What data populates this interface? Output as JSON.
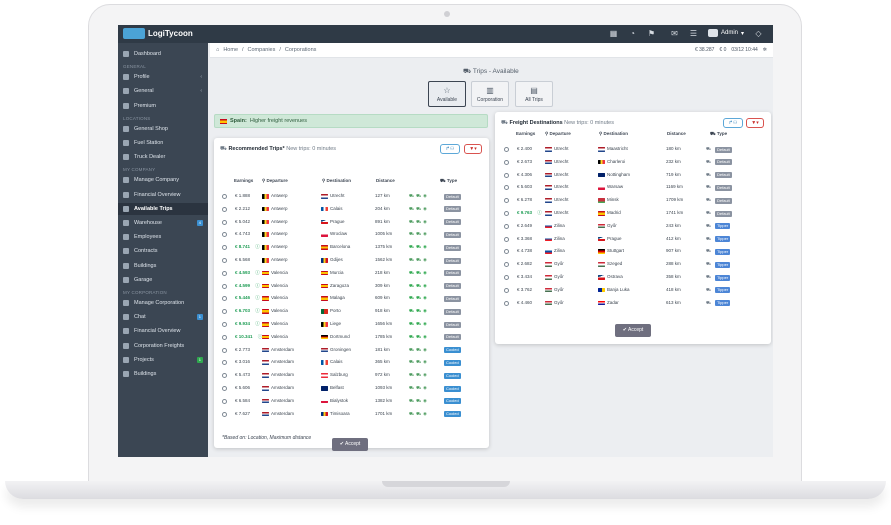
{
  "app": {
    "logo_text": "LogiTycoon",
    "admin_label": "Admin",
    "balance_1": "€ 38.287",
    "balance_2": "€ 0",
    "date": "03/12 10:44"
  },
  "breadcrumb": [
    "Home",
    "Companies",
    "Corporations"
  ],
  "sidebar": {
    "groups": [
      {
        "label": "",
        "items": [
          {
            "label": "Dashboard"
          }
        ]
      },
      {
        "label": "GENERAL",
        "items": [
          {
            "label": "Profile"
          },
          {
            "label": "General"
          },
          {
            "label": "Premium"
          }
        ]
      },
      {
        "label": "LOCATIONS",
        "items": [
          {
            "label": "General Shop"
          },
          {
            "label": "Fuel Station"
          },
          {
            "label": "Truck Dealer"
          }
        ]
      },
      {
        "label": "MY COMPANY",
        "items": [
          {
            "label": "Manage Company"
          },
          {
            "label": "Financial Overview"
          },
          {
            "label": "Available Trips"
          },
          {
            "label": "Warehouse"
          },
          {
            "label": "Employees"
          },
          {
            "label": "Contracts"
          },
          {
            "label": "Buildings"
          },
          {
            "label": "Garage"
          }
        ]
      },
      {
        "label": "MY CORPORATION",
        "items": [
          {
            "label": "Manage Corporation"
          },
          {
            "label": "Chat"
          },
          {
            "label": "Financial Overview"
          },
          {
            "label": "Corporation Freights"
          },
          {
            "label": "Projects"
          },
          {
            "label": "Buildings"
          }
        ]
      }
    ]
  },
  "page": {
    "title": "Trips - Available"
  },
  "categories": [
    {
      "label": "Available"
    },
    {
      "label": "Corporation"
    },
    {
      "label": "All Trips"
    }
  ],
  "alert": {
    "country": "Spain:",
    "text": "Higher freight revenues"
  },
  "recommended": {
    "title": "Recommended Trips*",
    "subtitle": "New trips: 0 minutes",
    "headers": {
      "earnings": "Earnings",
      "departure": "Departure",
      "destination": "Destination",
      "distance": "Distance",
      "type": "Type"
    },
    "accept": "Accept",
    "footnote": "*Based on: Location, Maximum distance",
    "rows": [
      {
        "earn": "€ 1.888",
        "green": false,
        "dep": "Antwerp",
        "depc": "be",
        "dest": "Utrecht",
        "destc": "nl",
        "dist": "127 km",
        "type": "Default"
      },
      {
        "earn": "€ 2.212",
        "green": false,
        "dep": "Antwerp",
        "depc": "be",
        "dest": "Calais",
        "destc": "fr",
        "dist": "204 km",
        "type": "Default"
      },
      {
        "earn": "€ 5.042",
        "green": false,
        "dep": "Antwerp",
        "depc": "be",
        "dest": "Prague",
        "destc": "cz",
        "dist": "891 km",
        "type": "Default"
      },
      {
        "earn": "€ 4.743",
        "green": false,
        "dep": "Antwerp",
        "depc": "be",
        "dest": "Wroclaw",
        "destc": "pl",
        "dist": "1005 km",
        "type": "Default"
      },
      {
        "earn": "€ 8.741",
        "green": true,
        "dep": "Antwerp",
        "depc": "be",
        "dest": "Barcelona",
        "destc": "es",
        "dist": "1375 km",
        "type": "Default"
      },
      {
        "earn": "€ 6.568",
        "green": false,
        "dep": "Antwerp",
        "depc": "be",
        "dest": "Gdijes",
        "destc": "ro",
        "dist": "1562 km",
        "type": "Default"
      },
      {
        "earn": "€ 4.593",
        "green": true,
        "dep": "Valencia",
        "depc": "es",
        "dest": "Murcia",
        "destc": "es",
        "dist": "218 km",
        "type": "Default"
      },
      {
        "earn": "€ 4.599",
        "green": true,
        "dep": "Valencia",
        "depc": "es",
        "dest": "Zaragoza",
        "destc": "es",
        "dist": "309 km",
        "type": "Default"
      },
      {
        "earn": "€ 5.446",
        "green": true,
        "dep": "Valencia",
        "depc": "es",
        "dest": "Malaga",
        "destc": "es",
        "dist": "609 km",
        "type": "Default"
      },
      {
        "earn": "€ 6.703",
        "green": true,
        "dep": "Valencia",
        "depc": "es",
        "dest": "Porto",
        "destc": "pt",
        "dist": "918 km",
        "type": "Default"
      },
      {
        "earn": "€ 9.934",
        "green": true,
        "dep": "Valencia",
        "depc": "es",
        "dest": "Liege",
        "destc": "be",
        "dist": "1656 km",
        "type": "Default"
      },
      {
        "earn": "€ 10.341",
        "green": true,
        "dep": "Valencia",
        "depc": "es",
        "dest": "Dortmund",
        "destc": "de",
        "dist": "1785 km",
        "type": "Default"
      },
      {
        "earn": "€ 2.773",
        "green": false,
        "dep": "Amsterdam",
        "depc": "nl",
        "dest": "Groningen",
        "destc": "nl",
        "dist": "181 km",
        "type": "Cooled"
      },
      {
        "earn": "€ 3.016",
        "green": false,
        "dep": "Amsterdam",
        "depc": "nl",
        "dest": "Calais",
        "destc": "fr",
        "dist": "365 km",
        "type": "Cooled"
      },
      {
        "earn": "€ 5.473",
        "green": false,
        "dep": "Amsterdam",
        "depc": "nl",
        "dest": "Salzburg",
        "destc": "at",
        "dist": "972 km",
        "type": "Cooled"
      },
      {
        "earn": "€ 5.606",
        "green": false,
        "dep": "Amsterdam",
        "depc": "nl",
        "dest": "Belfast",
        "destc": "gb",
        "dist": "1093 km",
        "type": "Cooled"
      },
      {
        "earn": "€ 6.584",
        "green": false,
        "dep": "Amsterdam",
        "depc": "nl",
        "dest": "Bialystok",
        "destc": "pl",
        "dist": "1382 km",
        "type": "Cooled"
      },
      {
        "earn": "€ 7.627",
        "green": false,
        "dep": "Amsterdam",
        "depc": "nl",
        "dest": "Timisoara",
        "destc": "ro",
        "dist": "1701 km",
        "type": "Cooled"
      }
    ]
  },
  "freight": {
    "title": "Freight Destinations",
    "subtitle": "New trips: 0 minutes",
    "headers": {
      "earnings": "Earnings",
      "departure": "Departure",
      "destination": "Destination",
      "distance": "Distance",
      "type": "Type"
    },
    "accept": "Accept",
    "rows": [
      {
        "earn": "€ 2.400",
        "green": false,
        "dep": "Utrecht",
        "depc": "nl",
        "dest": "Maastricht",
        "destc": "nl",
        "dist": "180 km",
        "type": "Default"
      },
      {
        "earn": "€ 2.673",
        "green": false,
        "dep": "Utrecht",
        "depc": "nl",
        "dest": "Charleroi",
        "destc": "be",
        "dist": "232 km",
        "type": "Default"
      },
      {
        "earn": "€ 4.306",
        "green": false,
        "dep": "Utrecht",
        "depc": "nl",
        "dest": "Nottingham",
        "destc": "gb",
        "dist": "719 km",
        "type": "Default"
      },
      {
        "earn": "€ 5.603",
        "green": false,
        "dep": "Utrecht",
        "depc": "nl",
        "dest": "Warsaw",
        "destc": "pl",
        "dist": "1169 km",
        "type": "Default"
      },
      {
        "earn": "€ 6.278",
        "green": false,
        "dep": "Utrecht",
        "depc": "nl",
        "dest": "Minsk",
        "destc": "by",
        "dist": "1709 km",
        "type": "Default"
      },
      {
        "earn": "€ 9.763",
        "green": true,
        "dep": "Utrecht",
        "depc": "nl",
        "dest": "Madrid",
        "destc": "es",
        "dist": "1741 km",
        "type": "Default"
      },
      {
        "earn": "€ 2.649",
        "green": false,
        "dep": "Zilina",
        "depc": "sk",
        "dest": "Győr",
        "destc": "hu",
        "dist": "243 km",
        "type": "Tipper"
      },
      {
        "earn": "€ 3.368",
        "green": false,
        "dep": "Zilina",
        "depc": "sk",
        "dest": "Prague",
        "destc": "cz",
        "dist": "412 km",
        "type": "Tipper"
      },
      {
        "earn": "€ 4.738",
        "green": false,
        "dep": "Zilina",
        "depc": "sk",
        "dest": "Stuttgart",
        "destc": "de",
        "dist": "907 km",
        "type": "Tipper"
      },
      {
        "earn": "€ 2.682",
        "green": false,
        "dep": "Győr",
        "depc": "hu",
        "dest": "Szeged",
        "destc": "hu",
        "dist": "288 km",
        "type": "Tipper"
      },
      {
        "earn": "€ 3.434",
        "green": false,
        "dep": "Győr",
        "depc": "hu",
        "dest": "Ostrava",
        "destc": "cz",
        "dist": "358 km",
        "type": "Tipper"
      },
      {
        "earn": "€ 3.762",
        "green": false,
        "dep": "Győr",
        "depc": "hu",
        "dest": "Banja Luka",
        "destc": "ba",
        "dist": "418 km",
        "type": "Tipper"
      },
      {
        "earn": "€ 4.460",
        "green": false,
        "dep": "Győr",
        "depc": "hu",
        "dest": "Zadar",
        "destc": "hr",
        "dist": "613 km",
        "type": "Tipper"
      }
    ]
  },
  "colors": {
    "sidebar": "#3b4653",
    "topbar": "#2f3a46",
    "accent_green": "#1f9d55",
    "accept_btn": "#6f6f7f"
  }
}
